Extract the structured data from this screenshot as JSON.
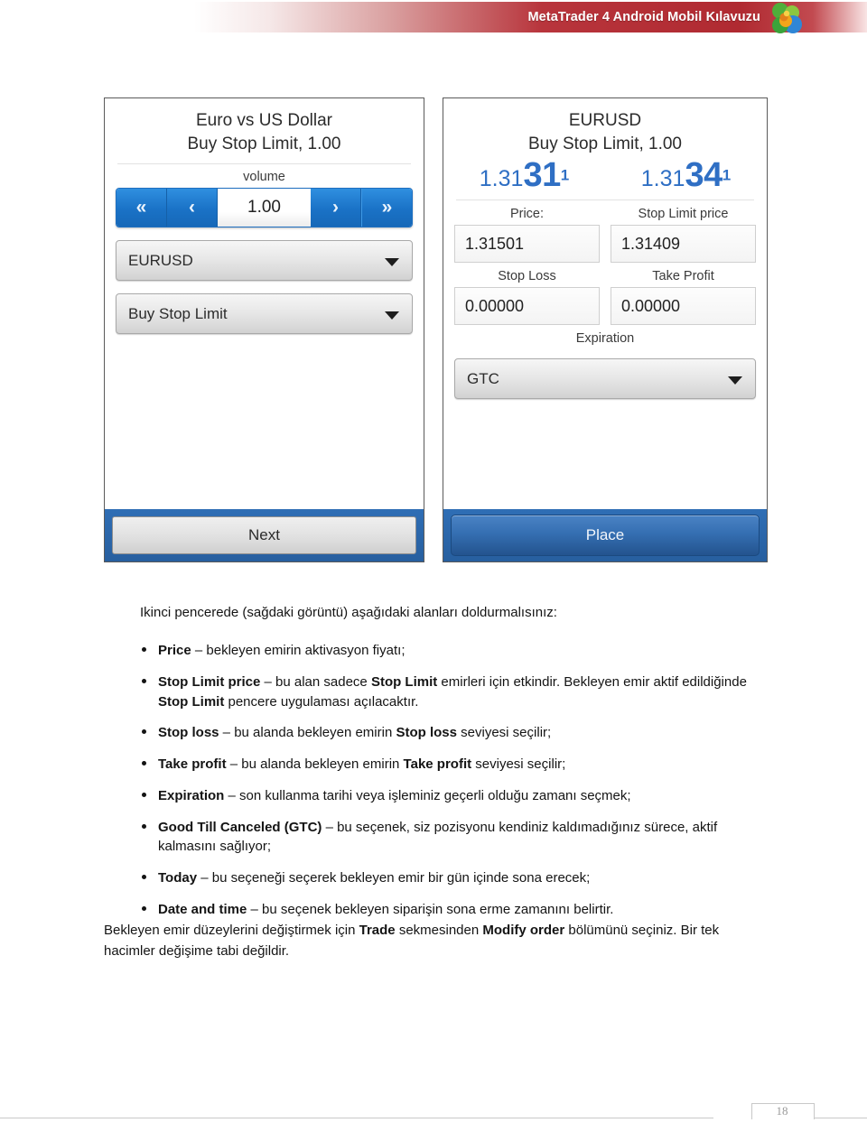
{
  "header": {
    "title": "MetaTrader 4 Android Mobil Kılavuzu",
    "logo_icon": "metaquotes-spheres-logo-icon",
    "banner_color": "#b02a31"
  },
  "screenshots": {
    "left_phone": {
      "title_line1": "Euro vs US Dollar",
      "title_line2": "Buy Stop Limit, 1.00",
      "volume_label": "volume",
      "stepper": {
        "fast_decrease_icon": "double-chevron-left-icon",
        "fast_decrease_glyph": "«",
        "decrease_icon": "chevron-left-icon",
        "decrease_glyph": "‹",
        "value": "1.00",
        "increase_icon": "chevron-right-icon",
        "increase_glyph": "›",
        "fast_increase_icon": "double-chevron-right-icon",
        "fast_increase_glyph": "»"
      },
      "symbol_spinner": "EURUSD",
      "order_type_spinner": "Buy Stop Limit",
      "action_button": "Next"
    },
    "right_phone": {
      "title_line1": "EURUSD",
      "title_line2": "Buy Stop Limit, 1.00",
      "bid": {
        "prefix": "1.31",
        "big": "31",
        "sup": "1"
      },
      "ask": {
        "prefix": "1.31",
        "big": "34",
        "sup": "1"
      },
      "quote_color": "#2f6fc4",
      "fields": [
        {
          "label": "Price:",
          "value": "1.31501"
        },
        {
          "label": "Stop Limit price",
          "value": "1.31409"
        },
        {
          "label": "Stop Loss",
          "value": "0.00000"
        },
        {
          "label": "Take Profit",
          "value": "0.00000"
        }
      ],
      "expiration_label": "Expiration",
      "expiration_value": "GTC",
      "action_button": "Place"
    }
  },
  "content": {
    "intro": "Ikinci pencerede (sağdaki görüntü) aşağıdaki alanları doldurmalısınız:",
    "bullets": [
      "<b>Price</b> – bekleyen emirin aktivasyon fiyatı;",
      "<b>Stop Limit price</b> – bu alan sadece <b>Stop Limit</b> emirleri için etkindir. Bekleyen emir aktif edildiğinde <b>Stop Limit</b> pencere uygulaması açılacaktır.",
      "<b>Stop loss</b> – bu alanda bekleyen emirin <b>Stop loss</b> seviyesi seçilir;",
      "<b>Take profit</b> – bu alanda bekleyen emirin <b>Take profit</b> seviyesi seçilir;",
      "<b>Expiration</b> – son kullanma tarihi veya işleminiz geçerli olduğu zamanı seçmek;",
      "<b>Good Till Canceled (GTC)</b> – bu seçenek, siz pozisyonu kendiniz kaldımadığınız sürece, aktif kalmasını sağlıyor;",
      "<b>Today</b> – bu seçeneği seçerek bekleyen emir bir gün içinde sona erecek;",
      "<b>Date and time</b> – bu seçenek bekleyen siparişin sona erme zamanını belirtir."
    ],
    "closing": "Bekleyen emir düzeylerini değiştirmek için <b>Trade</b> sekmesinden <b>Modify order</b> bölümünü seçiniz. Bir tek hacimler değişime tabi değildir."
  },
  "footer": {
    "page_number": "18"
  }
}
